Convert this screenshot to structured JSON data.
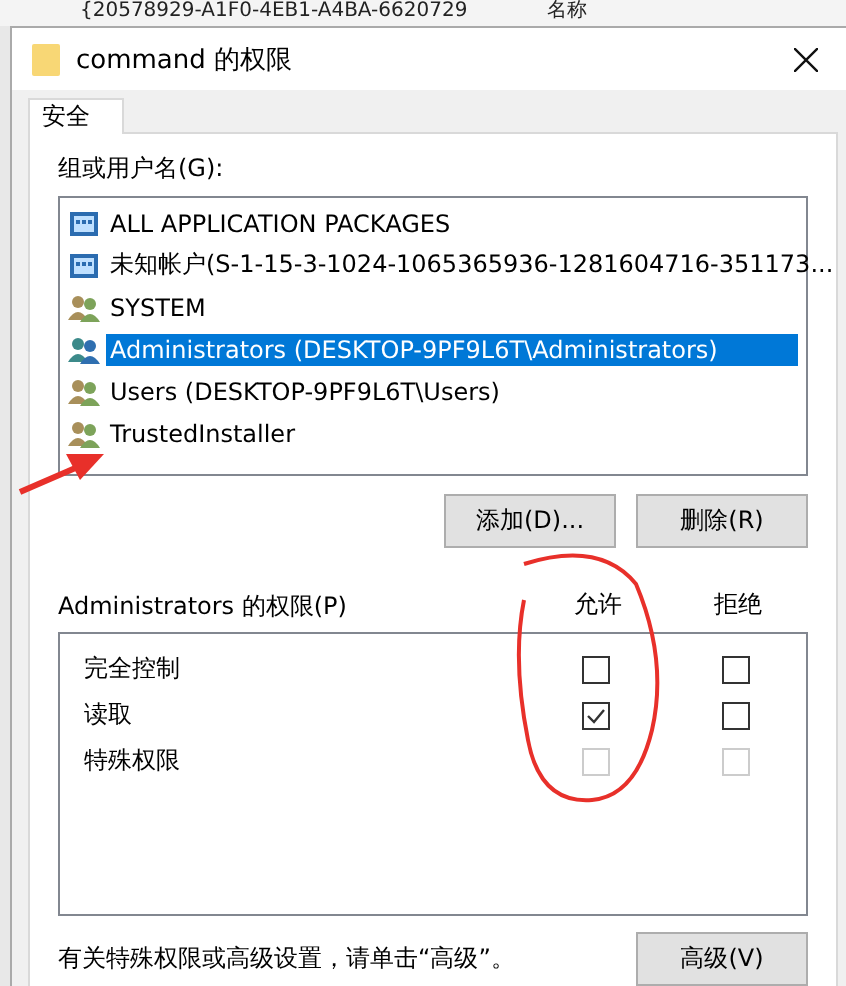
{
  "background_tab": {
    "title": "{20578929-A1F0-4EB1-A4BA-6620729",
    "column_header": "名称"
  },
  "window": {
    "title": "command 的权限"
  },
  "tabs": [
    {
      "label": "安全",
      "selected": true
    }
  ],
  "groups_label": "组或用户名(G):",
  "groups": [
    {
      "name": "ALL APPLICATION PACKAGES",
      "kind": "package",
      "selected": false
    },
    {
      "name": "未知帐户(S-1-15-3-1024-1065365936-1281604716-351173...",
      "kind": "package",
      "selected": false
    },
    {
      "name": "SYSTEM",
      "kind": "users",
      "selected": false
    },
    {
      "name": "Administrators (DESKTOP-9PF9L6T\\Administrators)",
      "kind": "admins",
      "selected": true
    },
    {
      "name": "Users (DESKTOP-9PF9L6T\\Users)",
      "kind": "users",
      "selected": false
    },
    {
      "name": "TrustedInstaller",
      "kind": "users",
      "selected": false
    }
  ],
  "buttons": [
    "添加(D)...",
    "删除(R)"
  ],
  "permissions": {
    "label": "Administrators 的权限(P)",
    "columns": [
      "允许",
      "拒绝"
    ],
    "rows": [
      {
        "name": "完全控制",
        "allow": {
          "checked": false,
          "disabled": false
        },
        "deny": {
          "checked": false,
          "disabled": false
        }
      },
      {
        "name": "读取",
        "allow": {
          "checked": true,
          "disabled": false
        },
        "deny": {
          "checked": false,
          "disabled": false
        }
      },
      {
        "name": "特殊权限",
        "allow": {
          "checked": false,
          "disabled": true
        },
        "deny": {
          "checked": false,
          "disabled": true
        }
      }
    ]
  },
  "footer": "有关特殊权限或高级设置，请单击“高级”。",
  "advanced_button": "高级(V)",
  "annotations": {
    "arrow": true,
    "loop": true
  }
}
